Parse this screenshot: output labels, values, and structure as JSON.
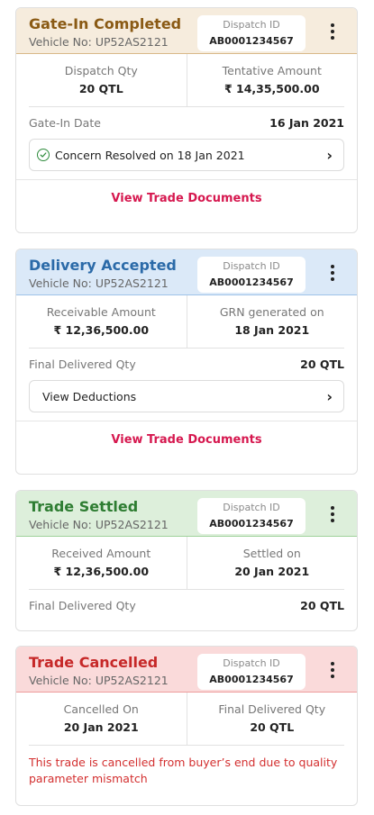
{
  "colors": {
    "gatein_bg": "#f6ecdd",
    "gatein_text": "#8a5a14",
    "gatein_border": "#d9b989",
    "delivery_bg": "#dbe9f8",
    "delivery_text": "#2b6aa8",
    "delivery_border": "#9ec2e8",
    "settled_bg": "#ddefdb",
    "settled_text": "#2e7d32",
    "settled_border": "#9fd29b",
    "cancelled_bg": "#fadada",
    "cancelled_text": "#c62828",
    "cancelled_border": "#ee9c9c",
    "link": "#d6184f"
  },
  "cards": [
    {
      "title": "Gate-In Completed",
      "vehicle": "Vehicle No: UP52AS2121",
      "dispatch_label": "Dispatch ID",
      "dispatch_id": "AB0001234567",
      "stats": [
        {
          "label": "Dispatch Qty",
          "value": "20 QTL"
        },
        {
          "label": "Tentative Amount",
          "value": "₹ 14,35,500.00"
        }
      ],
      "row": {
        "label": "Gate-In Date",
        "value": "16 Jan 2021"
      },
      "pill": {
        "text": "Concern Resolved on 18 Jan 2021",
        "icon": "check-circle-icon"
      },
      "link": "View Trade Documents"
    },
    {
      "title": "Delivery Accepted",
      "vehicle": "Vehicle No: UP52AS2121",
      "dispatch_label": "Dispatch ID",
      "dispatch_id": "AB0001234567",
      "stats": [
        {
          "label": "Receivable Amount",
          "value": "₹ 12,36,500.00"
        },
        {
          "label": "GRN generated on",
          "value": "18 Jan 2021"
        }
      ],
      "row": {
        "label": "Final Delivered Qty",
        "value": "20 QTL"
      },
      "pill": {
        "text": "View Deductions"
      },
      "link": "View Trade Documents"
    },
    {
      "title": "Trade Settled",
      "vehicle": "Vehicle No: UP52AS2121",
      "dispatch_label": "Dispatch ID",
      "dispatch_id": "AB0001234567",
      "stats": [
        {
          "label": "Received Amount",
          "value": "₹ 12,36,500.00"
        },
        {
          "label": "Settled on",
          "value": "20 Jan 2021"
        }
      ],
      "row": {
        "label": "Final Delivered Qty",
        "value": "20 QTL"
      }
    },
    {
      "title": "Trade Cancelled",
      "vehicle": "Vehicle No: UP52AS2121",
      "dispatch_label": "Dispatch ID",
      "dispatch_id": "AB0001234567",
      "stats": [
        {
          "label": "Cancelled On",
          "value": "20 Jan 2021"
        },
        {
          "label": "Final Delivered Qty",
          "value": "20 QTL"
        }
      ],
      "message": "This trade is cancelled from buyer’s end due to quality parameter mismatch"
    }
  ]
}
